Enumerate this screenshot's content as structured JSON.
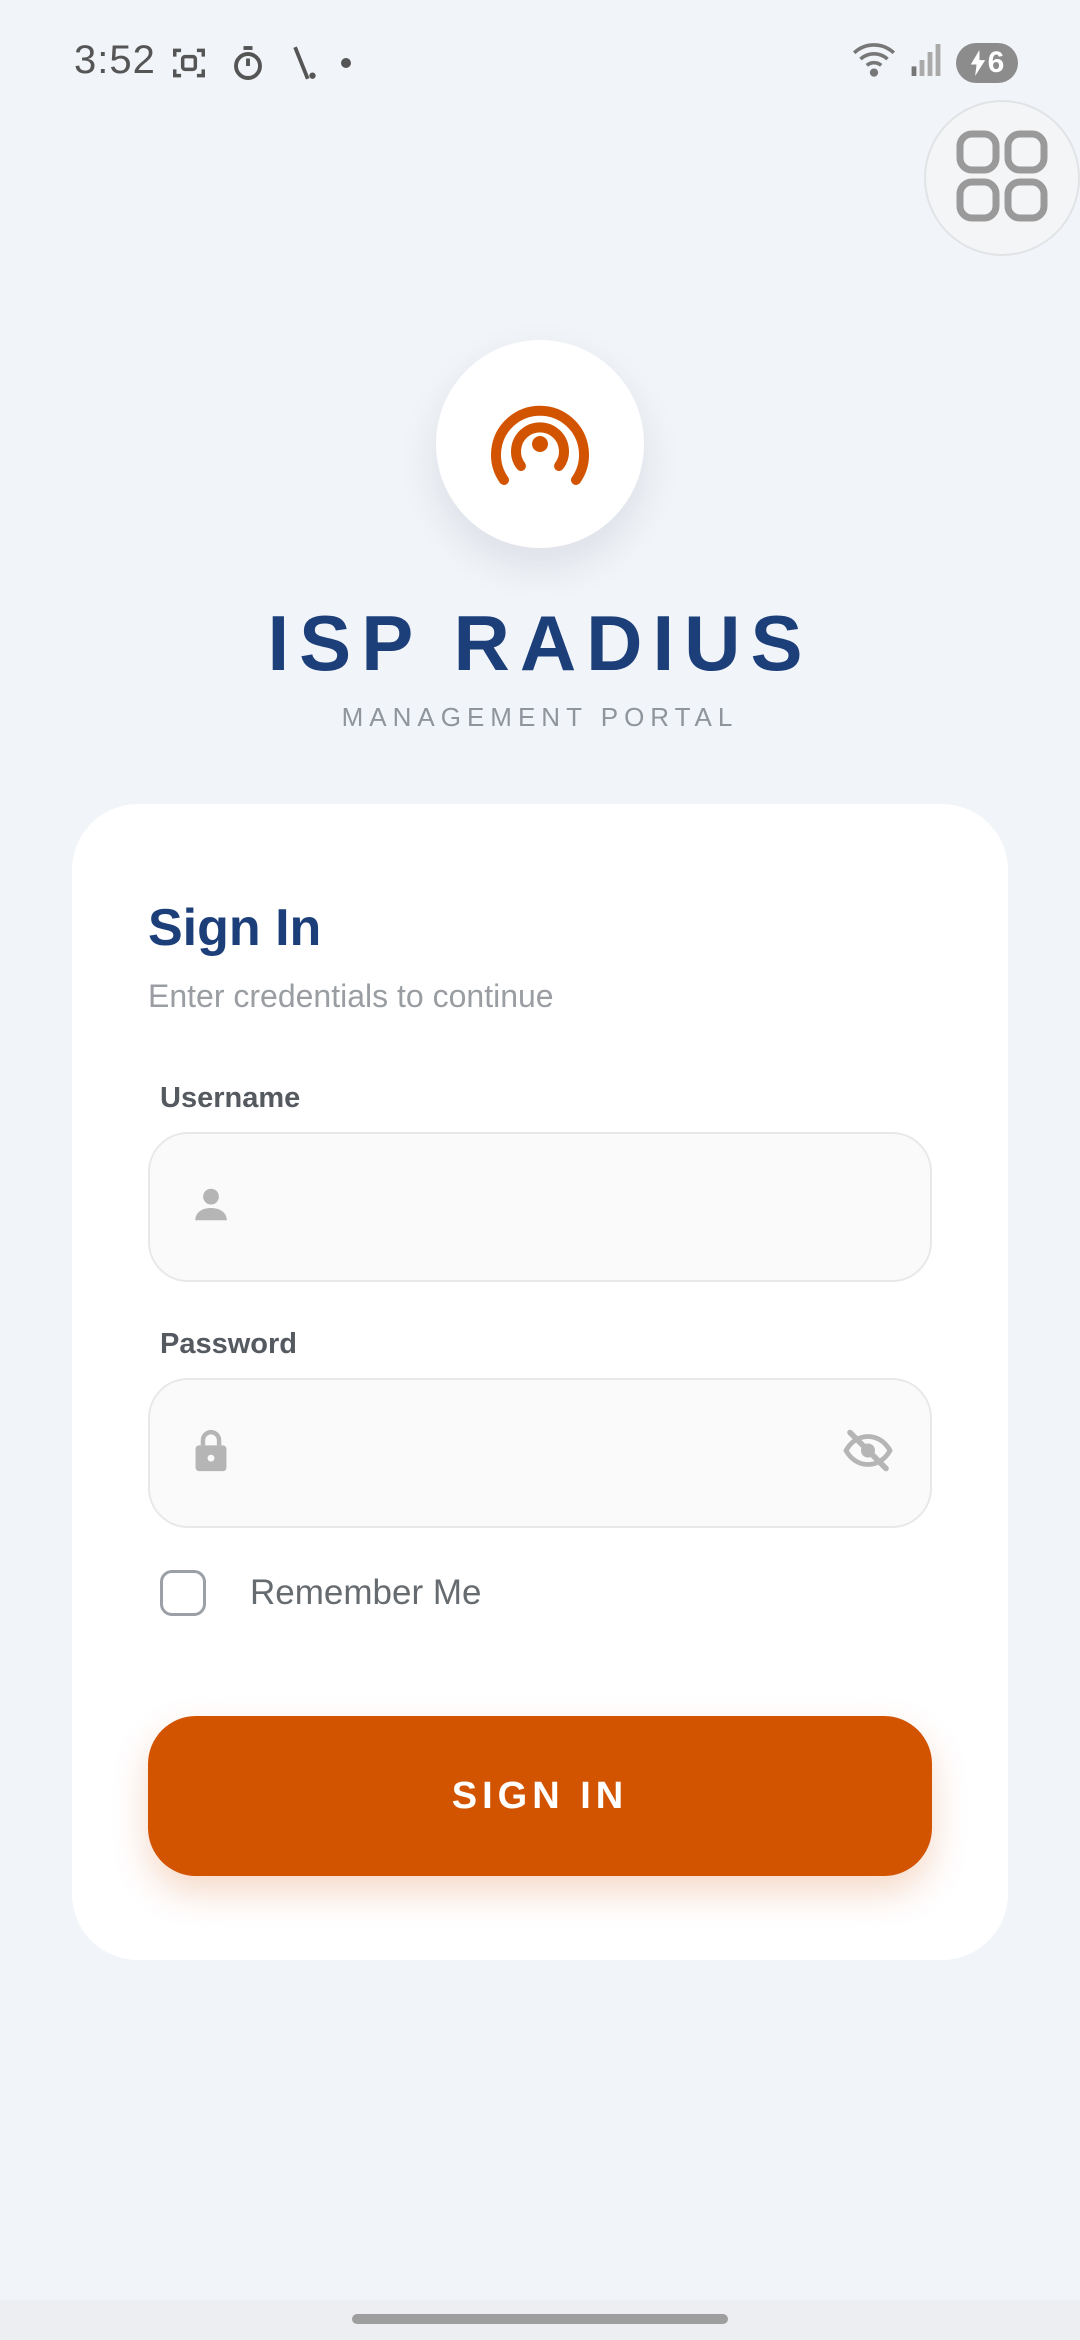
{
  "status_bar": {
    "time": "3:52",
    "battery_level": "6",
    "left_icons": [
      "screenshot-icon",
      "timer-icon",
      "slash-icon",
      "dot-icon"
    ],
    "right_icons": [
      "wifi-icon",
      "signal-icon",
      "battery-charging-icon"
    ]
  },
  "brand": {
    "logo_icon": "broadcast-icon",
    "title": "ISP RADIUS",
    "subtitle": "MANAGEMENT PORTAL"
  },
  "sign_in": {
    "title": "Sign In",
    "subtitle": "Enter credentials to continue",
    "username": {
      "label": "Username",
      "value": "",
      "placeholder": "",
      "icon": "person-icon"
    },
    "password": {
      "label": "Password",
      "value": "",
      "placeholder": "",
      "icon": "lock-icon",
      "toggle_icon": "eye-off-icon"
    },
    "remember_me": {
      "label": "Remember Me",
      "checked": false
    },
    "button_label": "SIGN IN"
  },
  "colors": {
    "primary_blue": "#1c3f7a",
    "accent_orange": "#d35400",
    "background": "#f1f4f8",
    "card": "#ffffff"
  }
}
